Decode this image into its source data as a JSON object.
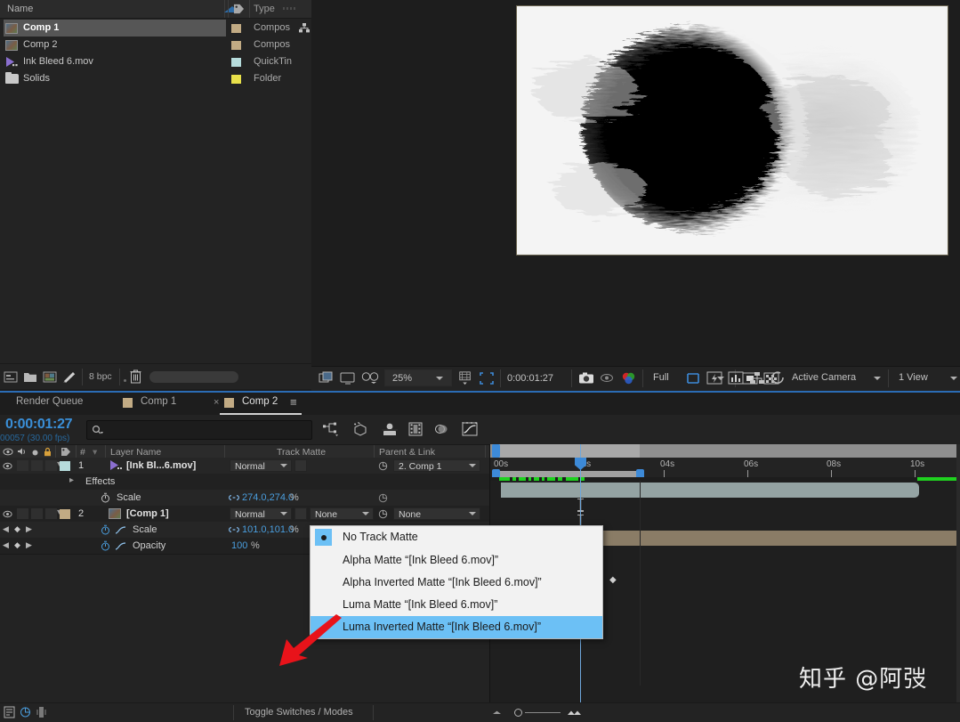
{
  "project_panel": {
    "columns": {
      "name": "Name",
      "type": "Type"
    },
    "items": [
      {
        "name": "Comp 1",
        "type": "Compos",
        "icon": "composition-icon",
        "swatch": "#c2ab84",
        "selected": true
      },
      {
        "name": "Comp 2",
        "type": "Compos",
        "icon": "composition-icon",
        "swatch": "#c2ab84",
        "selected": false
      },
      {
        "name": "Ink Bleed 6.mov",
        "type": "QuickTin",
        "icon": "movie-icon",
        "swatch": "#b6dcdc",
        "selected": false
      },
      {
        "name": "Solids",
        "type": "Folder",
        "icon": "folder-icon",
        "swatch": "#e8e04a",
        "selected": false
      }
    ],
    "toolbar": {
      "bit_depth": "8 bpc"
    }
  },
  "viewer_toolbar": {
    "magnification": "25%",
    "timecode": "0:00:01:27",
    "resolution": "Full",
    "view_camera": "Active Camera",
    "view_layout": "1 View"
  },
  "timeline": {
    "tabs": [
      {
        "label": "Render Queue",
        "active": false,
        "has_swatch": false
      },
      {
        "label": "Comp 1",
        "active": false,
        "has_swatch": true
      },
      {
        "label": "Comp 2",
        "active": true,
        "has_swatch": true
      }
    ],
    "current_time": "0:00:01:27",
    "frame_info": "00057 (30.00 fps)",
    "search_placeholder": "",
    "columns": {
      "layer_name": "Layer Name",
      "track_matte": "Track Matte",
      "parent_link": "Parent & Link"
    },
    "layers": [
      {
        "index": "1",
        "name": "[Ink Bl...6.mov]",
        "mode": "Normal",
        "track_matte": "",
        "parent": "2. Comp 1",
        "swatch": "#b6dcdc"
      },
      {
        "index": "",
        "name": "Effects",
        "mode": "",
        "track_matte": "",
        "parent": "",
        "swatch": ""
      },
      {
        "index": "",
        "name": "Scale",
        "value": "274.0,274.0",
        "unit": "%",
        "mode": "",
        "track_matte": "",
        "parent": "",
        "swatch": ""
      },
      {
        "index": "2",
        "name": "[Comp 1]",
        "mode": "Normal",
        "track_matte": "None",
        "parent": "None",
        "swatch": "#c2ab84"
      },
      {
        "index": "",
        "name": "Scale",
        "value": "101.0,101.0",
        "unit": "%",
        "mode": "",
        "track_matte": "",
        "parent": "",
        "swatch": ""
      },
      {
        "index": "",
        "name": "Opacity",
        "value": "100",
        "unit": "%",
        "mode": "",
        "track_matte": "",
        "parent": "",
        "swatch": ""
      }
    ],
    "ruler_ticks": [
      "00s",
      "02s",
      "04s",
      "06s",
      "08s",
      "10s"
    ],
    "bottom_bar": {
      "toggle_label": "Toggle Switches / Modes"
    }
  },
  "track_matte_menu": {
    "items": [
      {
        "label": "No Track Matte",
        "selected": false,
        "checked": true
      },
      {
        "label": "Alpha Matte “[Ink Bleed 6.mov]”",
        "selected": false,
        "checked": false
      },
      {
        "label": "Alpha Inverted Matte “[Ink Bleed 6.mov]”",
        "selected": false,
        "checked": false
      },
      {
        "label": "Luma Matte “[Ink Bleed 6.mov]”",
        "selected": false,
        "checked": false
      },
      {
        "label": "Luma Inverted Matte “[Ink Bleed 6.mov]”",
        "selected": true,
        "checked": false
      }
    ]
  },
  "watermark": "知乎 @阿弢",
  "colors": {
    "accent_blue": "#3d8ad8",
    "value_blue": "#4a9ede",
    "highlight": "#6cc0f5",
    "arrow_red": "#e8131a"
  }
}
